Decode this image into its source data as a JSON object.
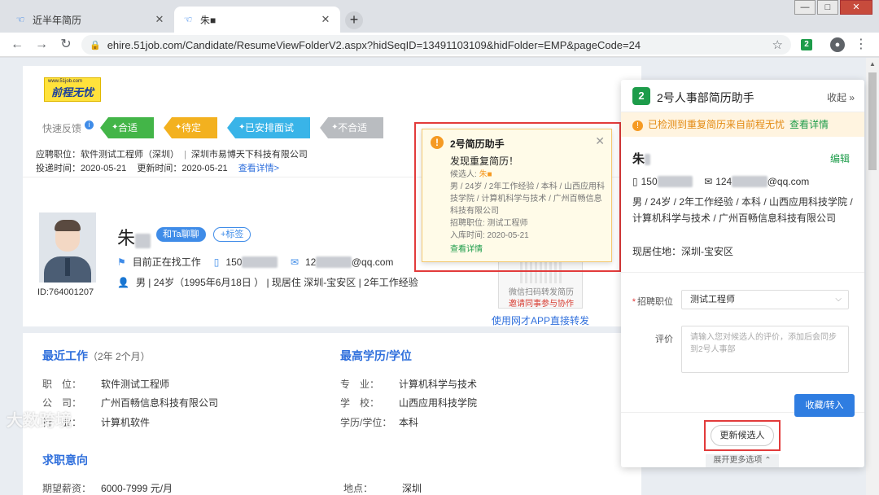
{
  "browser": {
    "tabs": [
      {
        "label": "近半年简历",
        "icon": "hand-icon"
      },
      {
        "label": "朱■",
        "icon": "hand-icon"
      }
    ],
    "url": "ehire.51job.com/Candidate/ResumeViewFolderV2.aspx?hidSeqID=13491103109&hidFolder=EMP&pageCode=24",
    "extension_badge": "2"
  },
  "logo": {
    "small": "www.51job.com",
    "big": "前程无忧"
  },
  "quick_feedback": {
    "label": "快速反馈",
    "buttons": [
      "合适",
      "待定",
      "已安排面试",
      "不合适"
    ]
  },
  "job": {
    "position_line": "应聘职位：软件测试工程师（深圳）",
    "company": "深圳市易博天下科技有限公司",
    "delivery": "投递时间：2020-05-21",
    "update": "更新时间：2020-05-21",
    "detail_link": "查看详情>"
  },
  "candidate": {
    "name": "朱",
    "chat_label": "和Ta聊聊",
    "tag_label": "+标签",
    "id": "ID:764001207",
    "status": "目前正在找工作",
    "phone": "150",
    "email_prefix": "12",
    "email_suffix": "@qq.com",
    "profile": "男 | 24岁（1995年6月18日 ） | 现居住 深圳-宝安区 | 2年工作经验"
  },
  "qr": {
    "caption": "微信扫码转发简历",
    "invite": "邀请同事参与协作",
    "app_link": "使用网才APP直接转发"
  },
  "recent_work": {
    "title": "最近工作",
    "duration": "（2年 2个月）",
    "rows": [
      {
        "k": "职　位：",
        "v": "软件测试工程师"
      },
      {
        "k": "公　司：",
        "v": "广州百畅信息科技有限公司"
      },
      {
        "k": "行　业：",
        "v": "计算机软件"
      }
    ]
  },
  "education": {
    "title": "最高学历/学位",
    "rows": [
      {
        "k": "专　业：",
        "v": "计算机科学与技术"
      },
      {
        "k": "学　校：",
        "v": "山西应用科技学院"
      },
      {
        "k": "学历/学位：",
        "v": "本科"
      }
    ]
  },
  "intent": {
    "title": "求职意向",
    "salary_label": "期望薪资：",
    "salary": "6000-7999 元/月",
    "location_label": "地点：",
    "location": "深圳"
  },
  "popup": {
    "title": "2号简历助手",
    "subtitle": "发现重复简历！",
    "candidate_label": "候选人:",
    "candidate_name": "朱■",
    "detail": "男 / 24岁 / 2年工作经验 / 本科 / 山西应用科技学院 / 计算机科学与技术 / 广州百畅信息科技有限公司",
    "position": "招聘职位: 测试工程师",
    "date": "入库时间: 2020-05-21",
    "link": "查看详情"
  },
  "panel": {
    "logo": "2",
    "title": "2号人事部简历助手",
    "collapse": "收起",
    "alert": "已检测到重复简历来自前程无忧",
    "alert_link": "查看详情",
    "name": "朱",
    "edit": "编辑",
    "phone": "150",
    "email_prefix": "124",
    "email_suffix": "@qq.com",
    "desc": "男 / 24岁 / 2年工作经验 / 本科 / 山西应用科技学院 / 计算机科学与技术 / 广州百畅信息科技有限公司",
    "address": "现居住地：深圳-宝安区",
    "position_label": "招聘职位",
    "position_value": "测试工程师",
    "review_label": "评价",
    "review_placeholder": "请输入您对候选人的评价，添加后会同步到2号人事部",
    "update_button": "更新候选人",
    "expand": "展开更多选项"
  },
  "save_button": "收藏/转入",
  "watermark": "大数跨境"
}
